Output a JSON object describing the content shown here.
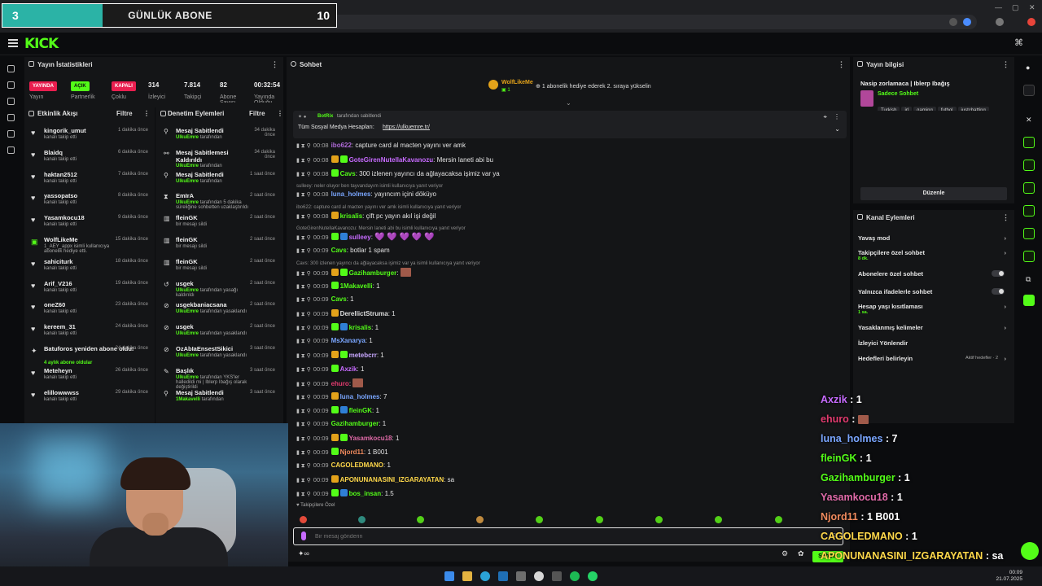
{
  "browser": {
    "url": "kick.com/stream",
    "goal": {
      "count": "3",
      "title": "GÜNLÜK ABONE",
      "target": "10",
      "progress": 0.3
    }
  },
  "stats_panel": {
    "title": "Yayın İstatistikleri",
    "pills": [
      {
        "badge": "YAYINDA",
        "label": "Yayın",
        "color": "#e91e4f"
      },
      {
        "badge": "AÇIK",
        "label": "Partnerlik",
        "color": "#53fc18"
      },
      {
        "badge": "KAPALI",
        "label": "Çoklu",
        "color": "#e91e4f"
      }
    ],
    "numbers": [
      {
        "value": "314",
        "label": "İzleyici"
      },
      {
        "value": "7.814",
        "label": "Takipçi"
      },
      {
        "value": "82",
        "label": "Abone Sayısı"
      },
      {
        "value": "00:32:54",
        "label": "Yayında Olduğu"
      }
    ]
  },
  "activity": {
    "title": "Etkinlik Akışı",
    "filter": "Filtre",
    "items": [
      {
        "name": "kingorik_umut",
        "sub": "kanalı takip etti",
        "time": "1 dakika önce"
      },
      {
        "name": "Blaidq",
        "sub": "kanalı takip etti",
        "time": "6 dakika önce"
      },
      {
        "name": "haktan2512",
        "sub": "kanalı takip etti",
        "time": "7 dakika önce"
      },
      {
        "name": "yassopatso",
        "sub": "kanalı takip etti",
        "time": "8 dakika önce"
      },
      {
        "name": "Yasamkocu18",
        "sub": "kanalı takip etti",
        "time": "9 dakika önce"
      },
      {
        "name": "WolfLikeMe",
        "sub": "1_AEY_appx isimli kullanıcıya abonelik hediye etti.",
        "time": "15 dakika önce"
      },
      {
        "name": "sahiciturk",
        "sub": "kanalı takip etti",
        "time": "18 dakika önce"
      },
      {
        "name": "Arif_V216",
        "sub": "kanalı takip etti",
        "time": "19 dakika önce"
      },
      {
        "name": "oneZ60",
        "sub": "kanalı takip etti",
        "time": "23 dakika önce"
      },
      {
        "name": "kereem_31",
        "sub": "kanalı takip etti",
        "time": "24 dakika önce"
      },
      {
        "name": "Batuforos yeniden abone oldu!",
        "sub": "4 aylık abone oldular",
        "time": "24 dakika önce"
      },
      {
        "name": "Meteheyn",
        "sub": "kanalı takip etti",
        "time": "26 dakika önce"
      },
      {
        "name": "elillowwwss",
        "sub": "kanalı takip etti",
        "time": "29 dakika önce"
      }
    ]
  },
  "moderation": {
    "title": "Denetim Eylemleri",
    "filter": "Filtre",
    "items": [
      {
        "title": "Mesaj Sabitlendi",
        "sub_user": "UlkuEmre",
        "sub": "tarafından",
        "time": "34 dakika önce"
      },
      {
        "title": "Mesaj Sabitlemesi Kaldırıldı",
        "sub_user": "UlkuEmre",
        "sub": "tarafından",
        "time": "34 dakika önce"
      },
      {
        "title": "Mesaj Sabitlendi",
        "sub_user": "UlkuEmre",
        "sub": "tarafından",
        "time": "1 saat önce"
      },
      {
        "title": "EmIrA",
        "sub_user": "UlkuEmre",
        "sub": "tarafından 5 dakika süreliğine sohbetten uzaklaştırıldı",
        "time": "2 saat önce"
      },
      {
        "title": "fleinGK",
        "sub_user": "",
        "sub": "bir mesajı sildi",
        "time": "2 saat önce"
      },
      {
        "title": "fleinGK",
        "sub_user": "",
        "sub": "bir mesajı sildi",
        "time": "2 saat önce"
      },
      {
        "title": "fleinGK",
        "sub_user": "",
        "sub": "bir mesajı sildi",
        "time": "2 saat önce"
      },
      {
        "title": "usgek",
        "sub_user": "UlkuEmre",
        "sub": "tarafından yasağı kaldırıldı",
        "time": "2 saat önce"
      },
      {
        "title": "usgekbaniacsana",
        "sub_user": "UlkuEmre",
        "sub": "tarafından yasaklandı",
        "time": "2 saat önce"
      },
      {
        "title": "usgek",
        "sub_user": "UlkuEmre",
        "sub": "tarafından yasaklandı",
        "time": "2 saat önce"
      },
      {
        "title": "OzAbIaEnsestSikici",
        "sub_user": "UlkuEmre",
        "sub": "tarafından yasaklandı",
        "time": "3 saat önce"
      },
      {
        "title": "Başlık",
        "sub_user": "UlkuEmre",
        "sub": "tarafından YKS'ler halledildi mi | Iblerp Ibağış olarak değiştirildi",
        "time": "3 saat önce"
      },
      {
        "title": "Mesaj Sabitlendi",
        "sub_user": "1Makavelli",
        "sub": "tarafından",
        "time": "3 saat önce"
      }
    ]
  },
  "chat": {
    "title": "Sohbet",
    "top_user": "WolfLikeMe",
    "top_user_count": "1",
    "top_note": "1 abonelik hediye ederek 2. sıraya yükselin",
    "pinned_by": "BotRix",
    "pinned_by_suffix": "tarafından sabitlendi",
    "pinned_text": "Tüm Sosyal Medya Hesapları:",
    "pinned_link": "https://ulkuemre.tr/",
    "messages": [
      {
        "time": "00:08",
        "user": "ibo622",
        "color": "#b06ad8",
        "text": "capture card al macten yayını ver amk"
      },
      {
        "time": "00:08",
        "user": "GoteGirenNutellaKavanozu",
        "color": "#c76bff",
        "text": "Mersin laneti abi bu"
      },
      {
        "time": "00:08",
        "user": "Cavs",
        "color": "#53fc18",
        "text": "300 izlenen yayıncı da ağlayacaksa işimiz var ya"
      },
      {
        "time": "00:08",
        "user": "luna_holmes",
        "color": "#7aa6ff",
        "text": "yayıncım içini döküyo",
        "reply": "sulleey: neler oluyor ben tayvandayım isimli kullanıcıya yanıt veriyor"
      },
      {
        "time": "00:08",
        "user": "krisalis",
        "color": "#53fc18",
        "text": "çift pc yayın akıl işi değil",
        "reply": "ibo622: capture card al macten yayını ver amk isimli kullanıcıya yanıt veriyor"
      },
      {
        "time": "00:09",
        "user": "sulleey",
        "color": "#c76bff",
        "text": "💜 💜 💜 💜 💜",
        "reply": "GoteGirenNutellaKavanozu: Mersin laneti abi bu isimli kullanıcıya yanıt veriyor"
      },
      {
        "time": "00:09",
        "user": "Cavs",
        "color": "#53fc18",
        "text": "botlar 1 spam"
      },
      {
        "time": "00:09",
        "user": "Gazihamburger",
        "color": "#53fc18",
        "text": "",
        "reply": "Cavs: 300 izlenen yayıncı da ağlayacaksa işimiz var ya isimli kullanıcıya yanıt veriyor"
      },
      {
        "time": "00:09",
        "user": "1Makavelli",
        "color": "#53fc18",
        "text": "1"
      },
      {
        "time": "00:09",
        "user": "Cavs",
        "color": "#53fc18",
        "text": "1"
      },
      {
        "time": "00:09",
        "user": "DerellictStruma",
        "color": "#dddddd",
        "text": "1"
      },
      {
        "time": "00:09",
        "user": "krisalis",
        "color": "#53fc18",
        "text": "1"
      },
      {
        "time": "00:09",
        "user": "MsXanarya",
        "color": "#7aa6ff",
        "text": "1"
      },
      {
        "time": "00:09",
        "user": "metebcrr",
        "color": "#c9a8ff",
        "text": "1"
      },
      {
        "time": "00:09",
        "user": "Axzik",
        "color": "#c76bff",
        "text": "1"
      },
      {
        "time": "00:09",
        "user": "ehuro",
        "color": "#e33b6f",
        "text": ""
      },
      {
        "time": "00:09",
        "user": "luna_holmes",
        "color": "#7aa6ff",
        "text": "7"
      },
      {
        "time": "00:09",
        "user": "fleinGK",
        "color": "#53fc18",
        "text": "1"
      },
      {
        "time": "00:09",
        "user": "Gazihamburger",
        "color": "#53fc18",
        "text": "1"
      },
      {
        "time": "00:09",
        "user": "Yasamkocu18",
        "color": "#e06aa8",
        "text": "1"
      },
      {
        "time": "00:09",
        "user": "Njord11",
        "color": "#f08a5d",
        "text": "1 B001"
      },
      {
        "time": "00:09",
        "user": "CAGOLEDMANO",
        "color": "#ffd84a",
        "text": "1"
      },
      {
        "time": "00:09",
        "user": "APONUNANASINI_IZGARAYATAN",
        "color": "#ffd84a",
        "text": "sa"
      },
      {
        "time": "00:09",
        "user": "bos_insan",
        "color": "#53fc18",
        "text": "1.5"
      }
    ],
    "followers_only": "Takipçilere Özel",
    "input_placeholder": "Bir mesaj gönderin",
    "send_label": "Sohbet"
  },
  "stream_info": {
    "title": "Yayın bilgisi",
    "stream_title": "Nasip zorlamaca | Iblerp Ibağış",
    "category": "Sadece Sohbet",
    "tags": [
      "Turkish",
      "irl",
      "gaming",
      "futbol",
      "justchatting"
    ],
    "edit_label": "Düzenle"
  },
  "channel_actions": {
    "title": "Kanal Eylemleri",
    "items": [
      {
        "label": "Yavaş mod",
        "sub": "",
        "control": "chevron"
      },
      {
        "label": "Takipçilere özel sohbet",
        "sub": "8 dk.",
        "control": "chevron"
      },
      {
        "label": "Abonelere özel sohbet",
        "sub": "",
        "control": "toggle"
      },
      {
        "label": "Yalnızca ifadelerle sohbet",
        "sub": "",
        "control": "toggle"
      },
      {
        "label": "Hesap yaşı kısıtlaması",
        "sub": "1 sa.",
        "control": "chevron"
      },
      {
        "label": "Yasaklanmış kelimeler",
        "sub": "",
        "control": "chevron"
      },
      {
        "label": "İzleyici Yönlendir",
        "sub": "",
        "control": "none"
      },
      {
        "label": "Hedefleri belirleyin",
        "sub": "",
        "control": "chevron",
        "extra": "Aktif hedefler · 2"
      }
    ]
  },
  "overlay_chat": [
    {
      "user": "Axzik",
      "text": "1",
      "color": "#c76bff"
    },
    {
      "user": "ehuro",
      "text": "",
      "color": "#e33b6f"
    },
    {
      "user": "luna_holmes",
      "text": "7",
      "color": "#7aa6ff"
    },
    {
      "user": "fleinGK",
      "text": "1",
      "color": "#53fc18"
    },
    {
      "user": "Gazihamburger",
      "text": "1",
      "color": "#53fc18"
    },
    {
      "user": "Yasamkocu18",
      "text": "1",
      "color": "#e06aa8"
    },
    {
      "user": "Njord11",
      "text": "1 B001",
      "color": "#f08a5d"
    },
    {
      "user": "CAGOLEDMANO",
      "text": "1",
      "color": "#ffd84a"
    },
    {
      "user": "APONUNANASINI_IZGARAYATAN",
      "text": "sa",
      "color": "#ffd84a"
    },
    {
      "user": "bos_insan",
      "text": "1.5",
      "color": "#53fc18"
    }
  ],
  "clock": {
    "time": "00:09",
    "date": "21.07.2025"
  }
}
